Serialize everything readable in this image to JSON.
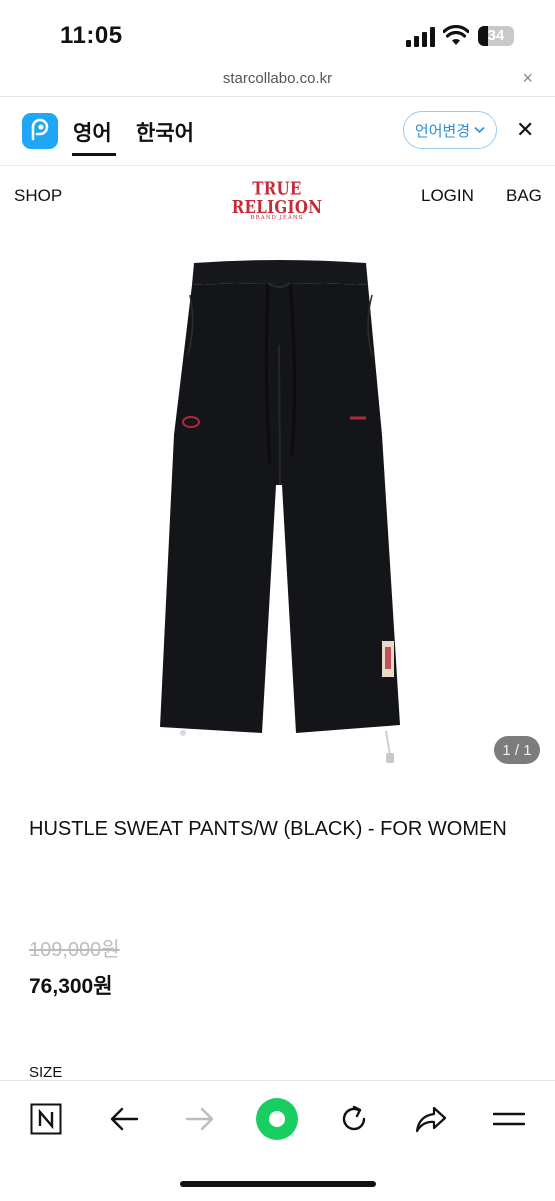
{
  "status_bar": {
    "time": "11:05",
    "battery": "34"
  },
  "url_bar": {
    "url": "starcollabo.co.kr",
    "close_label": "×"
  },
  "translate_bar": {
    "lang_english": "영어",
    "lang_korean": "한국어",
    "change_language_label": "언어변경",
    "close_label": "✕"
  },
  "site_header": {
    "shop_label": "SHOP",
    "brand_name": "TRUE RELIGION",
    "brand_sub": "BRAND JEANS",
    "login_label": "LOGIN",
    "bag_label": "BAG"
  },
  "gallery": {
    "counter": "1 / 1"
  },
  "product": {
    "title": "HUSTLE SWEAT PANTS/W (BLACK) - FOR WOMEN",
    "original_price": "109,000원",
    "sale_price": "76,300원",
    "size_label": "SIZE"
  },
  "toolbar": {
    "icons": [
      "naver-n-icon",
      "back-arrow-icon",
      "forward-arrow-icon",
      "green-dot-icon",
      "reload-icon",
      "share-icon",
      "menu-icon"
    ]
  },
  "colors": {
    "accent_blue": "#1fa7f5",
    "brand_red": "#c62a36",
    "green": "#19ce60"
  }
}
